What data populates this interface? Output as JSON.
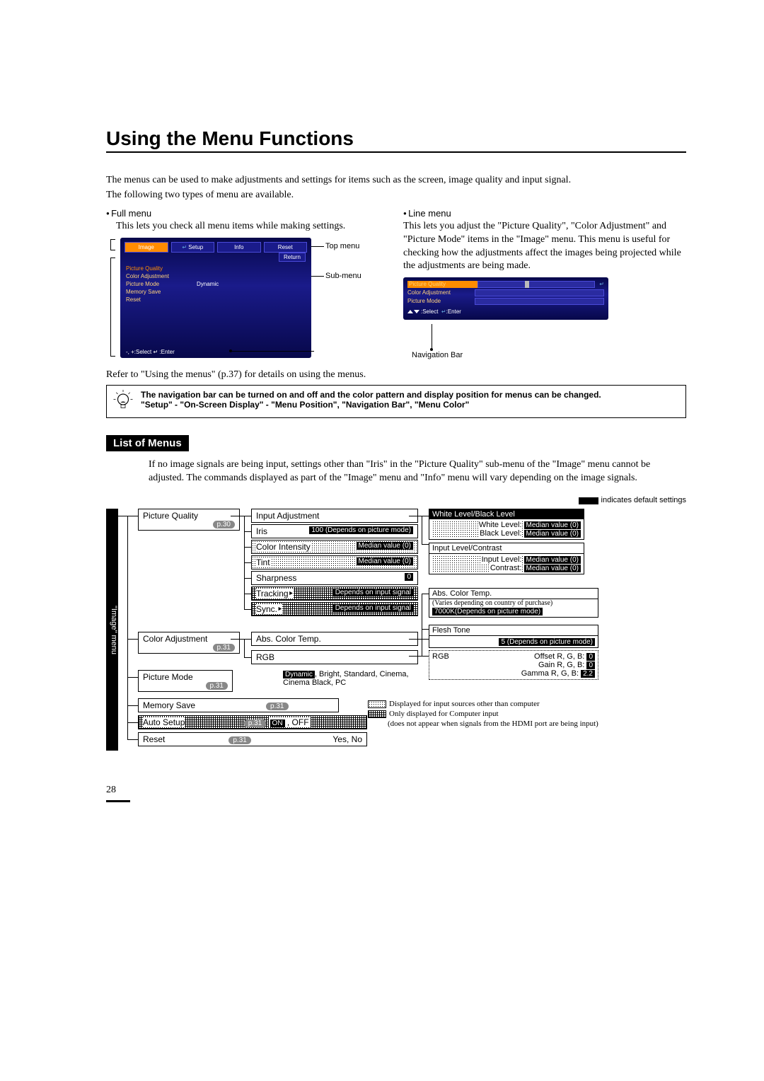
{
  "title": "Using the Menu Functions",
  "intro": {
    "p1": "The menus can be used to make adjustments and settings for items such as the screen, image quality and input signal.",
    "p2": "The following two types of menu are available."
  },
  "full_menu": {
    "label": "Full menu",
    "desc": "This lets you check all menu items while making settings.",
    "callouts": {
      "top": "Top menu",
      "return": "Return",
      "sub": "Sub-menu"
    },
    "osd": {
      "tabs": [
        "Image",
        "Setup",
        "Info",
        "Reset"
      ],
      "return": "Return",
      "items": [
        {
          "l": "Picture Quality",
          "r": ""
        },
        {
          "l": "Color Adjustment",
          "r": ""
        },
        {
          "l": "Picture Mode",
          "r": "Dynamic"
        },
        {
          "l": "Memory Save",
          "r": ""
        },
        {
          "l": "Reset",
          "r": ""
        }
      ],
      "footer": "-, +:Select   ↵  :Enter"
    }
  },
  "line_menu": {
    "label": "Line menu",
    "desc": "This lets you adjust the \"Picture Quality\", \"Color Adjustment\" and \"Picture Mode\" items in the \"Image\" menu. This menu is useful for checking how the adjustments affect the images being projected while the adjustments are being made.",
    "osd": {
      "rows": [
        "Picture Quality",
        "Color Adjustment",
        "Picture Mode"
      ],
      "footer_select": ":Select",
      "footer_enter": ":Enter"
    },
    "callout": "Navigation Bar"
  },
  "refer": "Refer to \"Using the menus\" (p.37) for details on using the menus.",
  "tip": {
    "l1": "The navigation bar can be turned on and off and the color pattern and display position for menus can be changed.",
    "l2": "\"Setup\" - \"On-Screen Display\" - \"Menu Position\", \"Navigation Bar\", \"Menu Color\""
  },
  "list_head": "List of Menus",
  "list_body": "If no image signals are being input, settings other than \"Iris\" in the \"Picture Quality\" sub-menu of the \"Image\" menu cannot be adjusted. The commands displayed as part of the \"Image\" menu and \"Info\" menu will vary depending on the image signals.",
  "legend": "indicates default settings",
  "side_tab": "\"Image\" menu",
  "col1": [
    {
      "label": "Picture Quality",
      "page": "p.30"
    },
    {
      "label": "Color Adjustment",
      "page": "p.31"
    },
    {
      "label": "Picture Mode",
      "page": ""
    },
    {
      "label": "Memory Save",
      "page": "p.31"
    },
    {
      "label": "Auto Setup",
      "page": "p.31",
      "opts": "ON , OFF",
      "on": "ON"
    },
    {
      "label": "Reset",
      "page": "p.31",
      "opts": "Yes, No"
    }
  ],
  "col2_pq": [
    {
      "label": "Input Adjustment"
    },
    {
      "label": "Iris",
      "val": "100 (Depends on picture mode)"
    },
    {
      "label": "Color Intensity",
      "val": "Median value (0)"
    },
    {
      "label": "Tint",
      "val": "Median value (0)"
    },
    {
      "label": "Sharpness",
      "val": "0"
    },
    {
      "label": "Tracking",
      "val": "Depends on input signal",
      "sym": true
    },
    {
      "label": "Sync.",
      "val": "Depends on input signal",
      "sym": true
    }
  ],
  "col2_ca": [
    {
      "label": "Abs. Color Temp."
    },
    {
      "label": "RGB"
    }
  ],
  "picture_mode_vals": {
    "default": "Dynamic",
    "rest": ", Bright, Standard, Cinema, Cinema Black, PC"
  },
  "right": {
    "wl": {
      "title": "White Level/Black Level",
      "r1l": "White Level:",
      "r1v": "Median value (0)",
      "r2l": "Black Level:",
      "r2v": "Median value (0)"
    },
    "il": {
      "title": "Input Level/Contrast",
      "r1l": "Input Level:",
      "r1v": "Median value (0)",
      "r2l": "Contrast:",
      "r2v": "Median value (0)"
    },
    "act": {
      "title": "Abs. Color Temp.",
      "note": "(Varies depending on country of purchase)",
      "val": "7000K(Depends on picture mode)"
    },
    "ft": {
      "title": "Flesh Tone",
      "val": "5 (Depends on picture mode)"
    },
    "rgb": {
      "title": "RGB",
      "r1": "Offset R, G, B:",
      "v1": "0",
      "r2": "Gain R, G, B:",
      "v2": "0",
      "r3": "Gamma R, G, B:",
      "v3": "2.2"
    }
  },
  "footnotes": {
    "a": "Displayed for input sources other than computer",
    "b": "Only displayed for Computer input",
    "c": "(does not appear when signals from the HDMI port are being input)"
  },
  "page_num": "28"
}
